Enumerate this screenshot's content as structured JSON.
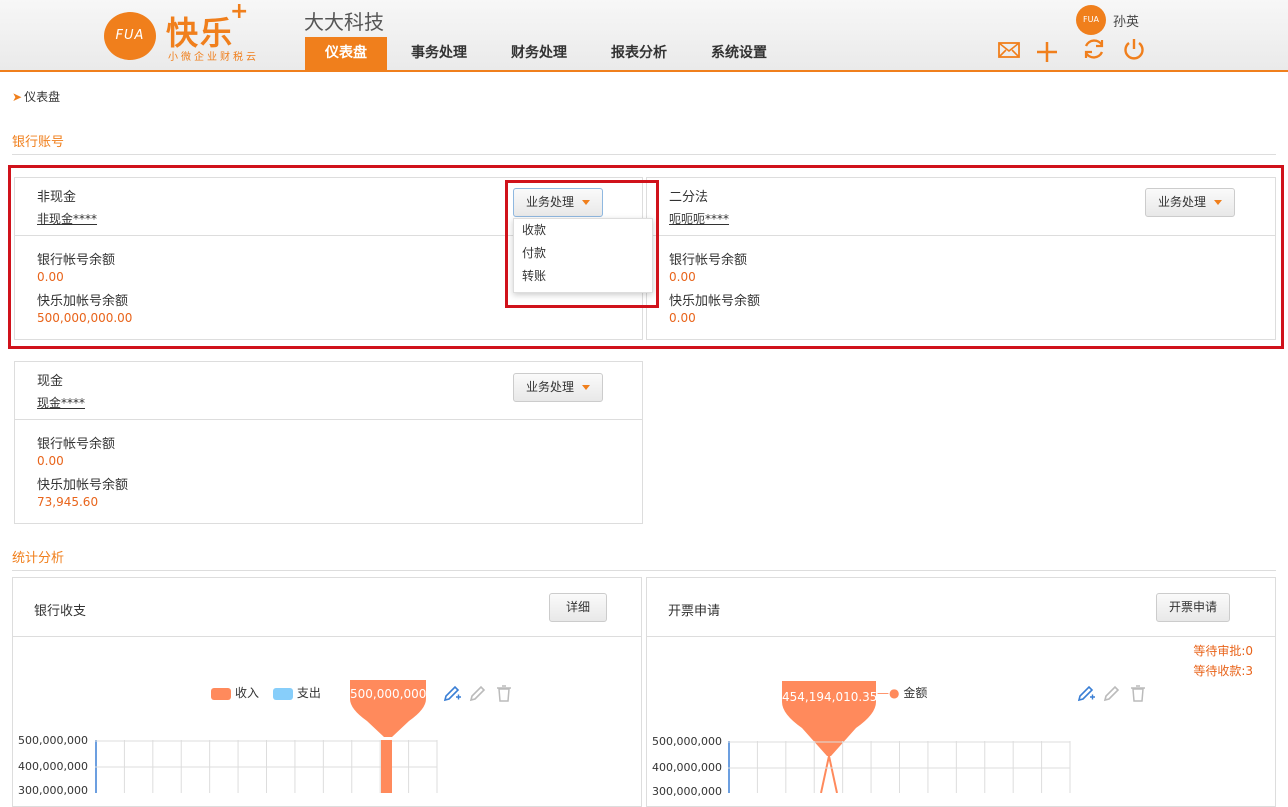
{
  "header": {
    "logo_text": "FUA",
    "brand": "快乐",
    "brand_plus": "+",
    "slogan": "小微企业财税云",
    "company": "大大科技",
    "nav": [
      "仪表盘",
      "事务处理",
      "财务处理",
      "报表分析",
      "系统设置"
    ],
    "active_nav": "仪表盘",
    "user_avatar": "FUA",
    "user_name": "孙英",
    "icons": [
      "mail-icon",
      "plus-icon",
      "refresh-icon",
      "power-icon"
    ]
  },
  "breadcrumb": {
    "label": "仪表盘"
  },
  "bank_section": {
    "title": "银行账号"
  },
  "accounts": [
    {
      "name": "非现金",
      "number": "非现金****",
      "action": "业务处理",
      "bank_label": "银行帐号余额",
      "bank_value": "0.00",
      "kl_label": "快乐加帐号余额",
      "kl_value": "500,000,000.00"
    },
    {
      "name": "二分法",
      "number": "呃呃呃****",
      "action": "业务处理",
      "bank_label": "银行帐号余额",
      "bank_value": "0.00",
      "kl_label": "快乐加帐号余额",
      "kl_value": "0.00"
    },
    {
      "name": "现金",
      "number": "现金****",
      "action": "业务处理",
      "bank_label": "银行帐号余额",
      "bank_value": "0.00",
      "kl_label": "快乐加帐号余额",
      "kl_value": "73,945.60"
    }
  ],
  "dropdown": {
    "items": [
      "收款",
      "付款",
      "转账"
    ]
  },
  "stats_section": {
    "title": "统计分析"
  },
  "bank_panel": {
    "title": "银行收支",
    "button": "详细",
    "legend": [
      {
        "name": "收入",
        "color": "#ff8a5c"
      },
      {
        "name": "支出",
        "color": "#87cefa"
      }
    ],
    "tooltip": "500,000,000",
    "y_ticks": [
      "500,000,000",
      "400,000,000",
      "300,000,000"
    ]
  },
  "invoice_panel": {
    "title": "开票申请",
    "button": "开票申请",
    "pending_approval": "等待审批:0",
    "pending_payment": "等待收款:3",
    "tooltip": "454,194,010.35",
    "legend": "金额",
    "y_ticks": [
      "500,000,000",
      "400,000,000",
      "300,000,000"
    ]
  }
}
